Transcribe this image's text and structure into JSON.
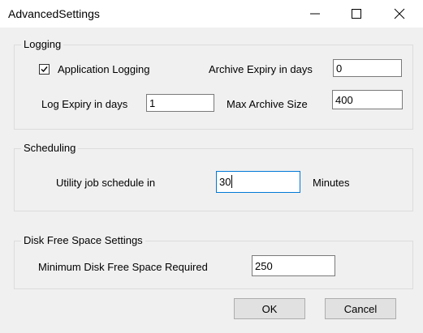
{
  "window": {
    "title": "AdvancedSettings",
    "controls": {
      "minimize_icon": "minimize-icon",
      "maximize_icon": "maximize-icon",
      "close_icon": "close-icon"
    }
  },
  "logging": {
    "legend": "Logging",
    "application_logging": {
      "label": "Application Logging",
      "checked": true
    },
    "archive_expiry": {
      "label": "Archive Expiry in days",
      "value": "0"
    },
    "log_expiry": {
      "label": "Log Expiry in days",
      "value": "1"
    },
    "max_archive_size": {
      "label": "Max Archive Size",
      "value": "400"
    }
  },
  "scheduling": {
    "legend": "Scheduling",
    "utility_job": {
      "label": "Utility job schedule in",
      "value": "30",
      "unit": "Minutes"
    }
  },
  "disk": {
    "legend": "Disk Free Space Settings",
    "min_free_space": {
      "label": "Minimum  Disk Free Space Required",
      "value": "250"
    }
  },
  "buttons": {
    "ok": "OK",
    "cancel": "Cancel"
  }
}
